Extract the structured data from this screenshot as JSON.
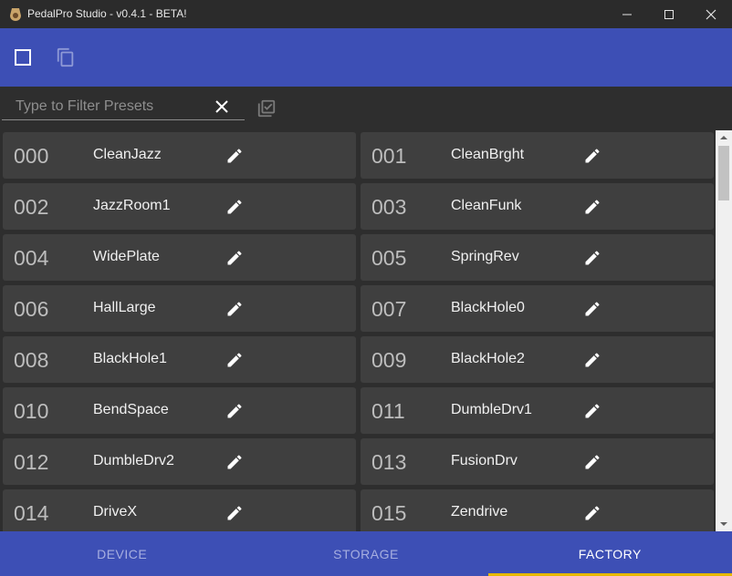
{
  "window": {
    "title": "PedalPro Studio - v0.4.1 - BETA!"
  },
  "toolbar": {
    "select_icon": "checkbox-outline-icon",
    "copy_icon": "copy-icon"
  },
  "filter": {
    "placeholder": "Type to Filter Presets",
    "value": ""
  },
  "presets": [
    {
      "num": "000",
      "name": "CleanJazz"
    },
    {
      "num": "001",
      "name": "CleanBrght"
    },
    {
      "num": "002",
      "name": "JazzRoom1"
    },
    {
      "num": "003",
      "name": "CleanFunk"
    },
    {
      "num": "004",
      "name": "WidePlate"
    },
    {
      "num": "005",
      "name": "SpringRev"
    },
    {
      "num": "006",
      "name": "HallLarge"
    },
    {
      "num": "007",
      "name": "BlackHole0"
    },
    {
      "num": "008",
      "name": "BlackHole1"
    },
    {
      "num": "009",
      "name": "BlackHole2"
    },
    {
      "num": "010",
      "name": "BendSpace"
    },
    {
      "num": "011",
      "name": "DumbleDrv1"
    },
    {
      "num": "012",
      "name": "DumbleDrv2"
    },
    {
      "num": "013",
      "name": "FusionDrv"
    },
    {
      "num": "014",
      "name": "DriveX"
    },
    {
      "num": "015",
      "name": "Zendrive"
    }
  ],
  "nav": {
    "tabs": [
      {
        "label": "DEVICE",
        "active": false
      },
      {
        "label": "STORAGE",
        "active": false
      },
      {
        "label": "FACTORY",
        "active": true
      }
    ]
  },
  "colors": {
    "accent": "#3d4fb5",
    "indicator": "#e6b800",
    "card": "#3f3f3f"
  }
}
